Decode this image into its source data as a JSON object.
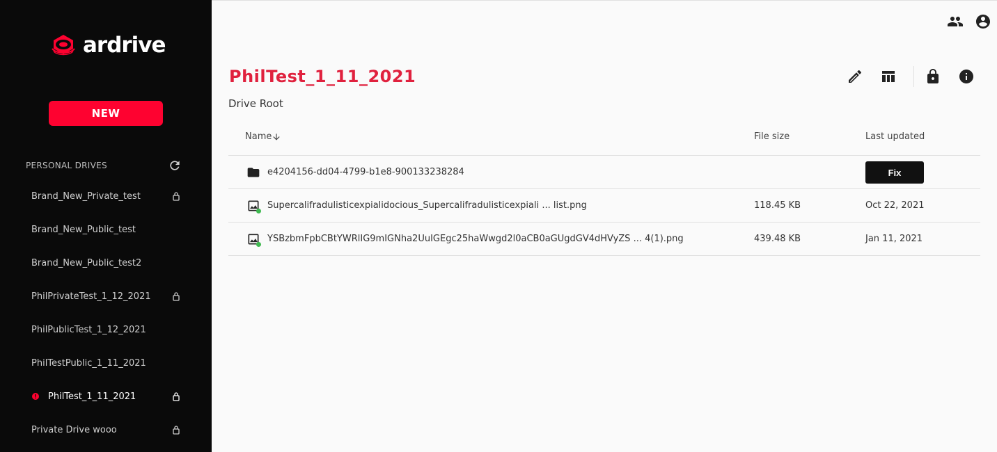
{
  "app": {
    "logo_text": "ardrive",
    "brand_color": "#fe0230"
  },
  "sidebar": {
    "new_button": "NEW",
    "section_title": "PERSONAL DRIVES",
    "refresh_icon": "refresh-icon",
    "drives": [
      {
        "label": "Brand_New_Private_test",
        "private": true,
        "active": false
      },
      {
        "label": "Brand_New_Public_test",
        "private": false,
        "active": false
      },
      {
        "label": "Brand_New_Public_test2",
        "private": false,
        "active": false
      },
      {
        "label": "PhilPrivateTest_1_12_2021",
        "private": true,
        "active": false
      },
      {
        "label": "PhilPublicTest_1_12_2021",
        "private": false,
        "active": false
      },
      {
        "label": "PhilTestPublic_1_11_2021",
        "private": false,
        "active": false
      },
      {
        "label": "PhilTest_1_11_2021",
        "private": true,
        "active": true
      },
      {
        "label": "Private Drive wooo",
        "private": true,
        "active": false
      }
    ]
  },
  "header": {
    "icons": [
      "shared-users-icon",
      "account-icon"
    ]
  },
  "drive": {
    "title": "PhilTest_1_11_2021",
    "title_color": "#e0213e",
    "breadcrumb": "Drive Root",
    "toolbar_icons": [
      "edit-icon",
      "view-toggle-icon",
      "lock-icon",
      "info-icon"
    ]
  },
  "table": {
    "columns": {
      "name": "Name",
      "name_sort_icon": "arrow-down-icon",
      "size": "File size",
      "updated": "Last updated"
    },
    "rows": [
      {
        "type": "folder",
        "name": "e4204156-dd04-4799-b1e8-900133238284",
        "size": "",
        "updated": "",
        "action": "Fix"
      },
      {
        "type": "image",
        "name": "Supercalifradulisticexpialidocious_Supercalifradulisticexpiali ... list.png",
        "size": "118.45 KB",
        "updated": "Oct 22, 2021",
        "synced": true
      },
      {
        "type": "image",
        "name": "YSBzbmFpbCBtYWRlIG9mIGNha2UuIGEgc25haWwgd2l0aCB0aGUgdGV4dHVyZS ... 4(1).png",
        "size": "439.48 KB",
        "updated": "Jan 11, 2021",
        "synced": true
      }
    ]
  }
}
